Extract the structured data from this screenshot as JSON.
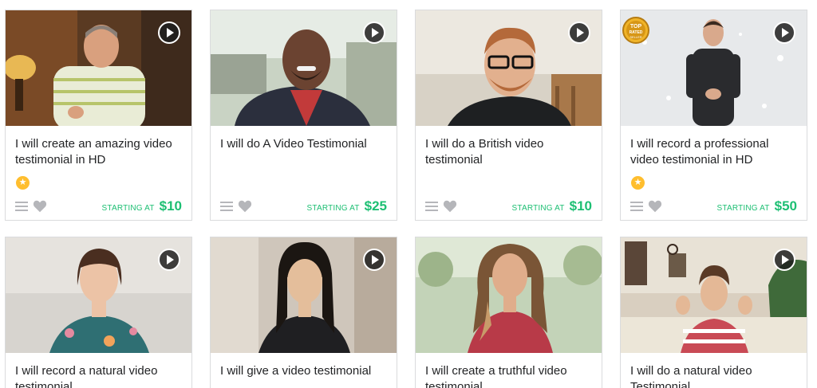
{
  "gigs": [
    {
      "title": "I will create an amazing video testimonial in HD",
      "has_level_badge": true,
      "has_top_rated": false,
      "starting_label": "STARTING AT",
      "price": "$10"
    },
    {
      "title": "I will do A Video Testimonial",
      "has_level_badge": false,
      "has_top_rated": false,
      "starting_label": "STARTING AT",
      "price": "$25"
    },
    {
      "title": "I will do a British video testimonial",
      "has_level_badge": false,
      "has_top_rated": false,
      "starting_label": "STARTING AT",
      "price": "$10"
    },
    {
      "title": "I will record a professional video testimonial in HD",
      "has_level_badge": true,
      "has_top_rated": true,
      "top_rated_text": "TOP RATED SELLER",
      "starting_label": "STARTING AT",
      "price": "$50"
    },
    {
      "title": "I will record a natural video testimonial"
    },
    {
      "title": "I will give a video testimonial"
    },
    {
      "title": "I will create a truthful video testimonial"
    },
    {
      "title": "I will do a natural video Testimonial"
    }
  ],
  "icons": {
    "play": "play-icon",
    "menu": "menu-icon",
    "heart": "heart-icon",
    "level": "star-icon",
    "top_rated": "top-rated-seller-badge"
  },
  "colors": {
    "price_green": "#1dbf73",
    "level_gold": "#ffbe2e",
    "icon_gray": "#b5b6ba",
    "title_text": "#222325"
  }
}
